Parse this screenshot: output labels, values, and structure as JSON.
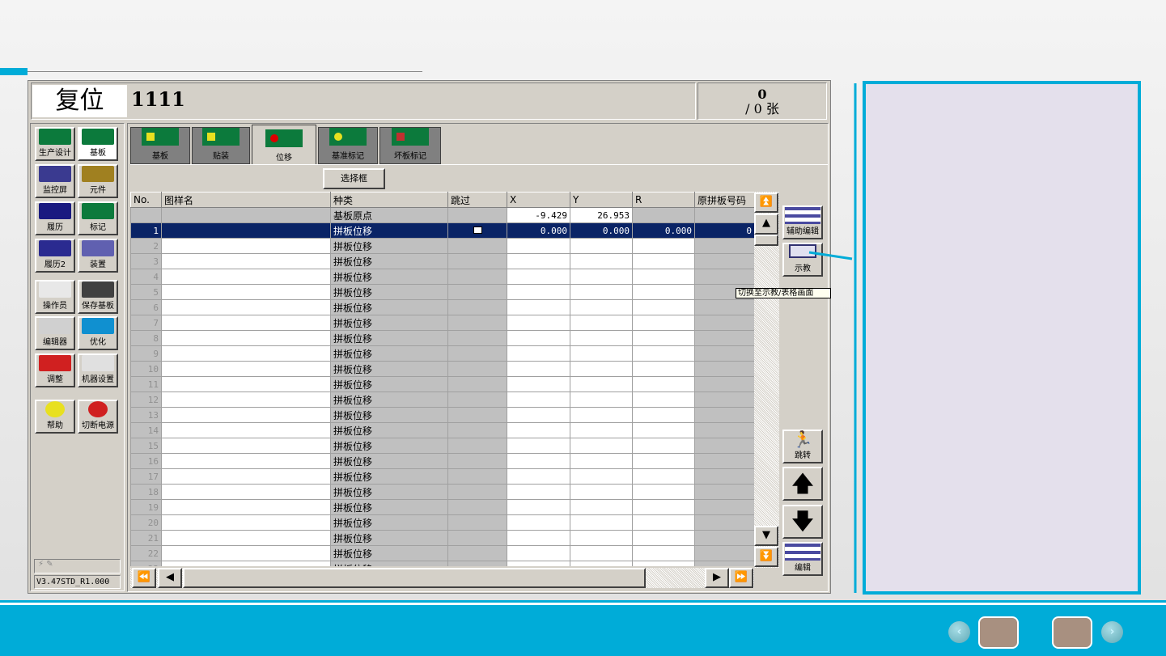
{
  "header": {
    "mode": "复位",
    "program": "1111",
    "count_top": "0",
    "count_bottom": "/ 0 张"
  },
  "sidebar": {
    "buttons": [
      {
        "label": "生产设计",
        "icon": "production-design-icon"
      },
      {
        "label": "基板",
        "icon": "board-icon"
      },
      {
        "label": "监控屏",
        "icon": "monitor-icon"
      },
      {
        "label": "元件",
        "icon": "component-icon"
      },
      {
        "label": "履历",
        "icon": "history-icon"
      },
      {
        "label": "标记",
        "icon": "mark-icon"
      },
      {
        "label": "履历2",
        "icon": "history2-icon"
      },
      {
        "label": "装置",
        "icon": "device-icon"
      },
      {
        "label": "操作员",
        "icon": "operator-icon"
      },
      {
        "label": "保存基板",
        "icon": "save-icon"
      },
      {
        "label": "编辑器",
        "icon": "editor-icon"
      },
      {
        "label": "优化",
        "icon": "optimize-icon"
      },
      {
        "label": "调整",
        "icon": "wrench-icon"
      },
      {
        "label": "机器设置",
        "icon": "gauge-icon"
      },
      {
        "label": "帮助",
        "icon": "help-icon"
      },
      {
        "label": "切断电源",
        "icon": "power-icon"
      }
    ],
    "version": "V3.47STD_R1.000"
  },
  "tabs": [
    {
      "label": "基板"
    },
    {
      "label": "贴装"
    },
    {
      "label": "位移",
      "active": true
    },
    {
      "label": "基准标记"
    },
    {
      "label": "坏板标记"
    }
  ],
  "select_frame_label": "选择框",
  "table": {
    "columns": [
      "No.",
      "图样名",
      "种类",
      "跳过",
      "X",
      "Y",
      "R",
      "原拼板号码"
    ],
    "origin_row": {
      "type": "基板原点",
      "x": "-9.429",
      "y": "26.953"
    },
    "rows_type": "拼板位移",
    "rows_count": 23,
    "selected_row": {
      "no": "1",
      "x": "0.000",
      "y": "0.000",
      "r": "0.000",
      "orig": "0"
    }
  },
  "right_buttons": {
    "aux_edit": "辅助编辑",
    "teach": "示教",
    "jump": "跳转",
    "edit": "编辑"
  },
  "tooltip": "切换至示教/表格画面",
  "colors": {
    "accent": "#00acd8",
    "selection": "#0a2466",
    "panel_bg": "#e4e0ec"
  }
}
